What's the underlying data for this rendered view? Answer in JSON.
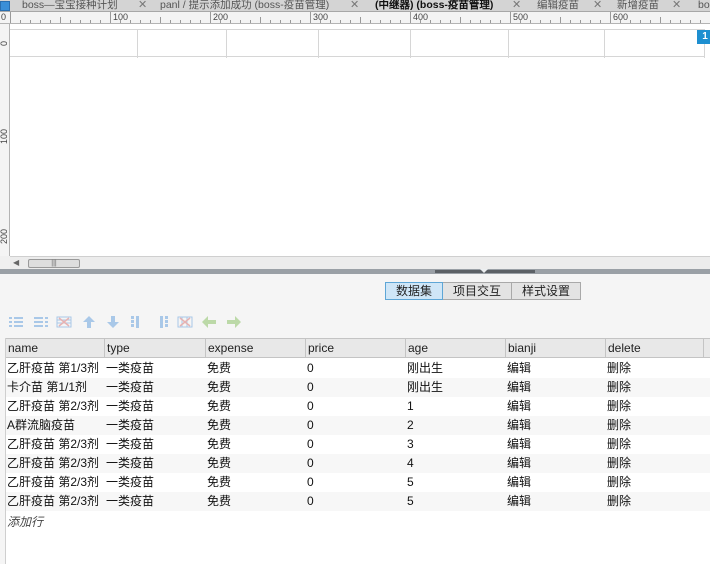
{
  "tabs": [
    {
      "label": "boss—宝宝接种计划",
      "active": false
    },
    {
      "label": "panl / 提示添加成功 (boss-疫苗管理)",
      "active": false
    },
    {
      "label": "(中继器) (boss-疫苗管理)",
      "active": true
    },
    {
      "label": "编辑疫苗",
      "active": false
    },
    {
      "label": "新增疫苗",
      "active": false
    },
    {
      "label": "bo",
      "active": false
    }
  ],
  "ruler": {
    "h_labels": [
      "0",
      "100",
      "200",
      "300",
      "400",
      "500",
      "600"
    ],
    "v_labels": [
      "0",
      "100",
      "200"
    ]
  },
  "canvas": {
    "page_badge": "1"
  },
  "scrollbar": {
    "left_arrow": "◀",
    "thumb_grip": "|||"
  },
  "subtabs": [
    {
      "label": "数据集",
      "active": true
    },
    {
      "label": "项目交互",
      "active": false
    },
    {
      "label": "样式设置",
      "active": false
    }
  ],
  "toolbar": {
    "icons": [
      "insert-row-above-icon",
      "insert-row-below-icon",
      "delete-row-icon",
      "move-up-icon",
      "move-down-icon",
      "insert-column-left-icon",
      "insert-column-right-icon",
      "delete-column-icon",
      "move-left-icon",
      "move-right-icon"
    ],
    "colors": {
      "disabled_blue": "#a9c8e8",
      "disabled_green": "#bcd9a8",
      "disabled_red": "#e6b3b3"
    }
  },
  "grid": {
    "columns": [
      "name",
      "type",
      "expense",
      "price",
      "age",
      "bianji",
      "delete"
    ],
    "rows": [
      [
        "乙肝疫苗 第1/3剂",
        "一类疫苗",
        "免费",
        "0",
        "刚出生",
        "编辑",
        "删除"
      ],
      [
        "卡介苗 第1/1剂",
        "一类疫苗",
        "免费",
        "0",
        "刚出生",
        "编辑",
        "删除"
      ],
      [
        "乙肝疫苗 第2/3剂",
        "一类疫苗",
        "免费",
        "0",
        "1",
        "编辑",
        "删除"
      ],
      [
        "A群流脑疫苗",
        "一类疫苗",
        "免费",
        "0",
        "2",
        "编辑",
        "删除"
      ],
      [
        "乙肝疫苗 第2/3剂",
        "一类疫苗",
        "免费",
        "0",
        "3",
        "编辑",
        "删除"
      ],
      [
        "乙肝疫苗 第2/3剂",
        "一类疫苗",
        "免费",
        "0",
        "4",
        "编辑",
        "删除"
      ],
      [
        "乙肝疫苗 第2/3剂",
        "一类疫苗",
        "免费",
        "0",
        "5",
        "编辑",
        "删除"
      ],
      [
        "乙肝疫苗 第2/3剂",
        "一类疫苗",
        "免费",
        "0",
        "5",
        "编辑",
        "删除"
      ]
    ],
    "add_row_label": "添加行"
  },
  "colors": {
    "accent": "#1e8fd0",
    "active_subtab": "#cfe6f7"
  }
}
